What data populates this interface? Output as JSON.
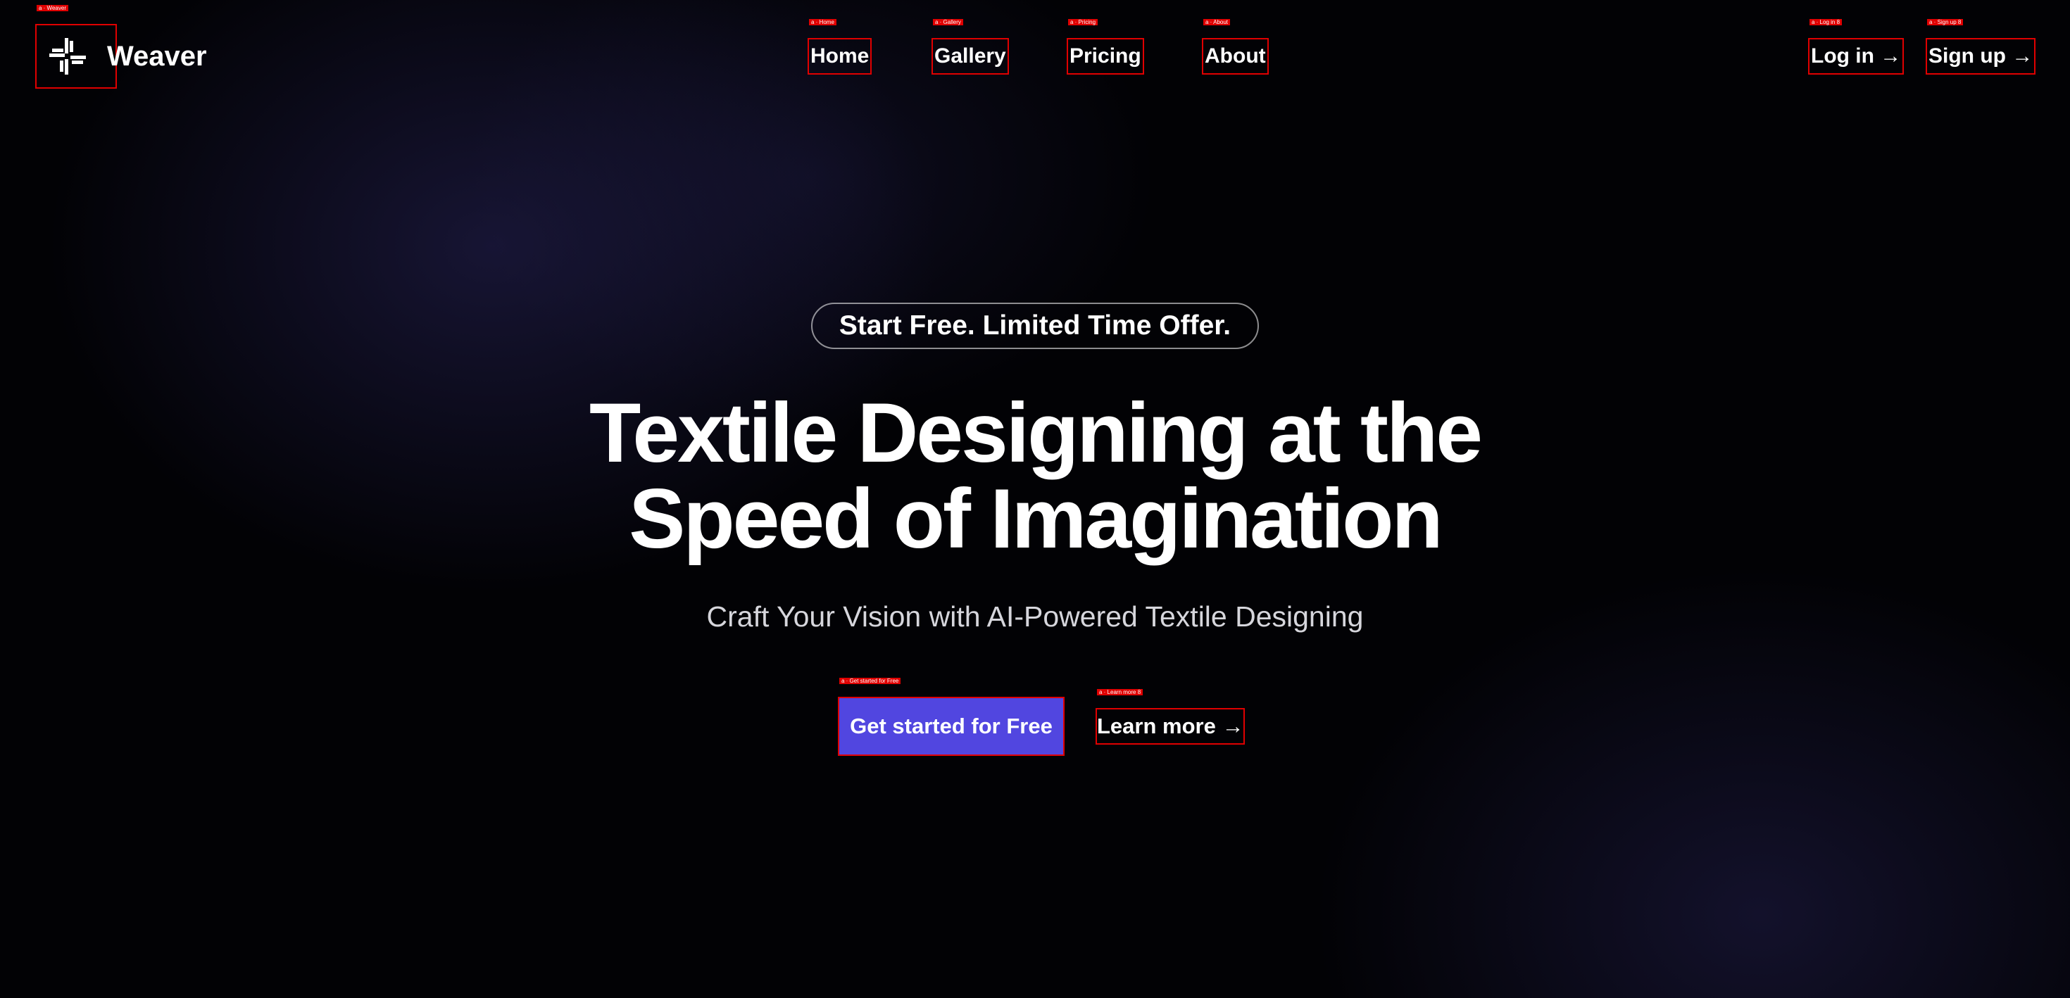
{
  "header": {
    "brand": {
      "name": "Weaver",
      "tag": "a · Weaver",
      "icon": "weave-logo-icon"
    },
    "nav": [
      {
        "label": "Home",
        "tag": "a · Home"
      },
      {
        "label": "Gallery",
        "tag": "a · Gallery"
      },
      {
        "label": "Pricing",
        "tag": "a · Pricing"
      },
      {
        "label": "About",
        "tag": "a · About"
      }
    ],
    "auth": {
      "login": {
        "label": "Log in →",
        "tag": "a · Log in 8"
      },
      "signup": {
        "label": "Sign up →",
        "tag": "a · Sign up 8"
      }
    }
  },
  "hero": {
    "badge": "Start Free. Limited Time Offer.",
    "headline_line1": "Textile Designing at the",
    "headline_line2": "Speed of Imagination",
    "subheadline": "Craft Your Vision with AI-Powered Textile Designing",
    "cta_primary": {
      "label": "Get started for Free",
      "tag": "a · Get started for Free"
    },
    "cta_secondary": {
      "label": "Learn more →",
      "tag": "a · Learn more 8"
    }
  },
  "colors": {
    "background": "#000000",
    "accent": "#5146e0",
    "text": "#ffffff",
    "muted_text": "#d6d6dc",
    "debug_outline": "#e00000"
  }
}
